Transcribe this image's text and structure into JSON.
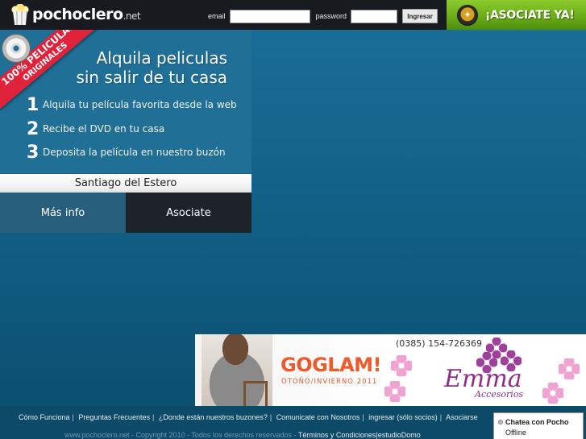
{
  "header": {
    "logo": {
      "name": "pochoclero",
      "tld": ".net"
    },
    "login": {
      "email_label": "email",
      "email_value": "",
      "password_label": "password",
      "password_value": "",
      "submit_label": "Ingresar"
    },
    "join_banner": {
      "label": "¡ASOCIATE YA!"
    }
  },
  "hero": {
    "ribbon_line1": "100% PELICULAS",
    "ribbon_line2": "ORIGINALES",
    "title_line1": "Alquila peliculas",
    "title_line2": "sin salir de tu casa",
    "steps": [
      {
        "num": "1",
        "text": "Alquila tu película favorita desde la web"
      },
      {
        "num": "2",
        "text": "Recibe el DVD en tu casa"
      },
      {
        "num": "3",
        "text": "Deposita la película en nuestro buzón"
      }
    ],
    "city": "Santiago del Estero",
    "more_info_label": "Más info",
    "join_label": "Asociate"
  },
  "sponsors": {
    "goglam": {
      "title": "GOGLAM!",
      "subtitle": "OTOÑO/INVIERNO 2011"
    },
    "emma": {
      "phone": "(0385) 154-726369",
      "name": "Emma",
      "subtitle": "Accesorios"
    }
  },
  "footer": {
    "links": [
      "Cómo Funciona",
      "Preguntas Frecuentes",
      "¿Donde están nuestros buzones?",
      "Comunicate con Nosotros",
      "ingresar (sólo socios)",
      "Asociarse"
    ],
    "copyright": "www.pochoclero.net - Copyright 2010 - Todos los derechos reservados - ",
    "terms": "Términos y Condiciones",
    "separator": "|",
    "credit": "estudioDomo"
  },
  "chat": {
    "title": "Chatea con Pocho",
    "status": "Offline"
  },
  "colors": {
    "background": "#13628a",
    "topbar": "#171b1f",
    "join_green": "#6aad18",
    "ribbon_red": "#e0233b",
    "footer": "#0c4a68"
  }
}
